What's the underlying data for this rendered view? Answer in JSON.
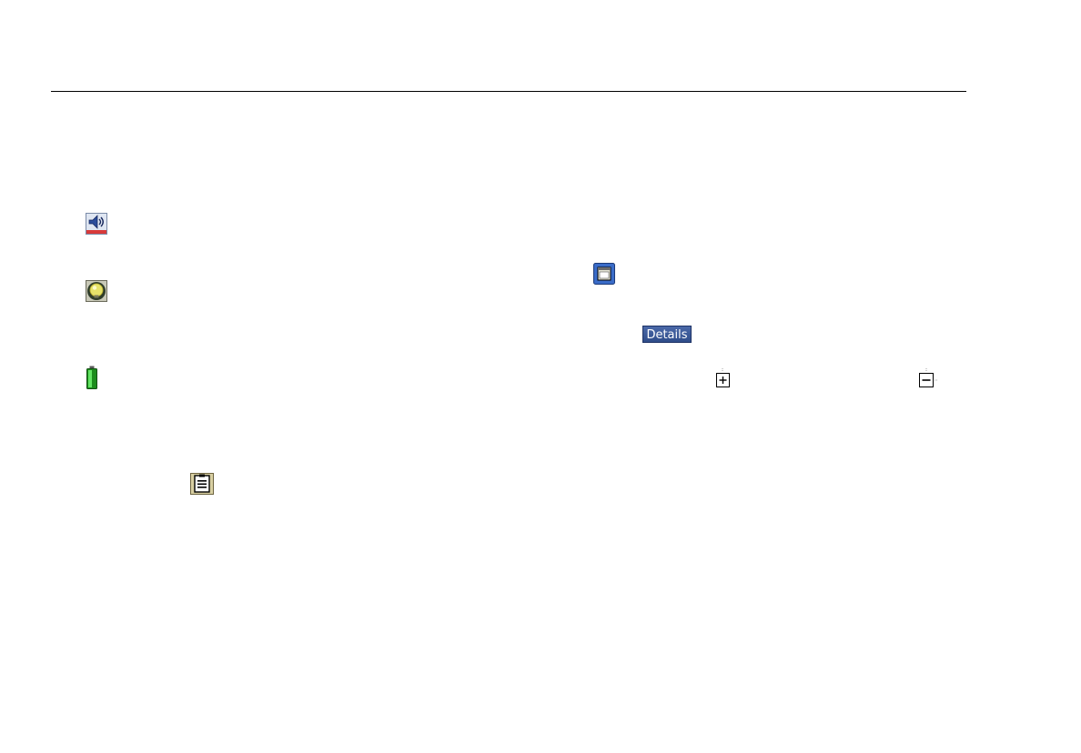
{
  "buttons": {
    "details_label": "Details"
  },
  "icons": {
    "speaker": "speaker-icon",
    "bulb": "light-bulb-icon",
    "battery": "battery-icon",
    "clipboard": "clipboard-icon",
    "window": "window-icon",
    "plus": "plus-icon",
    "minus": "minus-icon"
  },
  "colors": {
    "rule": "#000000",
    "button_background": "#3b5998",
    "battery_fill": "#3ecf3e"
  }
}
